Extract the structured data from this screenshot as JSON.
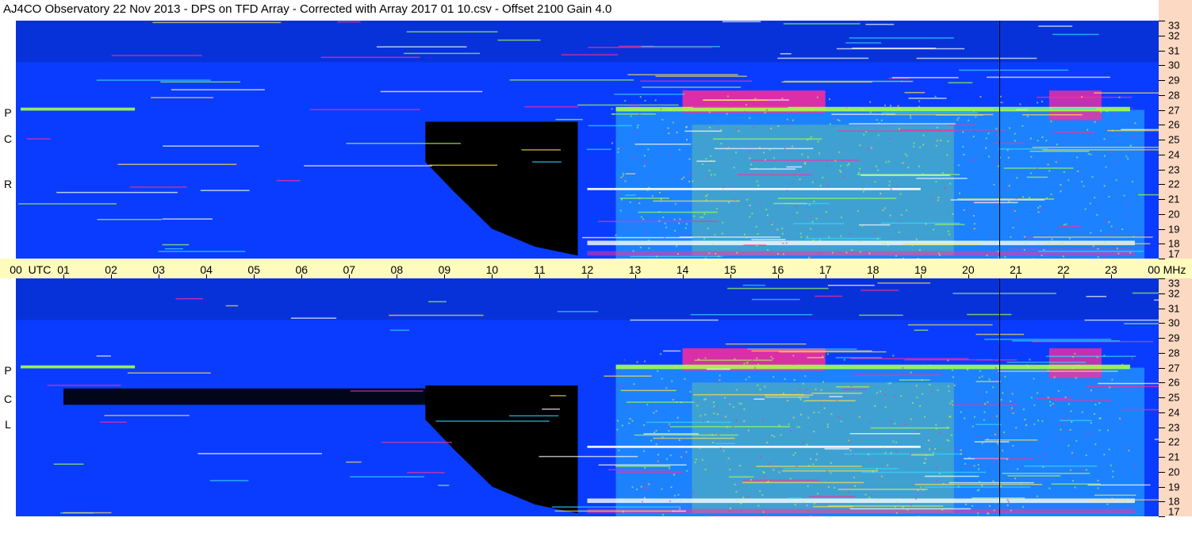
{
  "title": "AJ4CO Observatory  22 Nov 2013  -  DPS on TFD Array  -  Corrected with Array 2017 01 10.csv  -  Offset 2100  Gain 4.0",
  "panels": [
    {
      "id": "rcp",
      "polarization_label": [
        "R",
        "C",
        "P"
      ]
    },
    {
      "id": "lcp",
      "polarization_label": [
        "L",
        "C",
        "P"
      ]
    }
  ],
  "time_axis": {
    "labels": [
      "00",
      "UTC",
      "01",
      "02",
      "03",
      "04",
      "05",
      "06",
      "07",
      "08",
      "09",
      "10",
      "11",
      "12",
      "13",
      "14",
      "15",
      "16",
      "17",
      "18",
      "19",
      "20",
      "21",
      "22",
      "23",
      "00",
      "MHz"
    ]
  },
  "freq_axis": {
    "labels": [
      "33",
      "32",
      "31",
      "30",
      "29",
      "28",
      "27",
      "26",
      "25",
      "24",
      "23",
      "22",
      "21",
      "20",
      "19",
      "18",
      "17"
    ]
  },
  "colors": {
    "background_quiet": "#0a3cff",
    "absorption": "#000000",
    "time_band": "#fffbbd",
    "freq_band": "#fbd9c2",
    "intense_low": "#33d8ff",
    "intense_mid": "#a6ff4d",
    "intense_high": "#ff2d9a"
  },
  "chart_data": {
    "type": "heatmap",
    "title": "AJ4CO Observatory  22 Nov 2013  -  DPS on TFD Array  -  Corrected with Array 2017 01 10.csv  -  Offset 2100  Gain 4.0",
    "x_unit": "UTC hours",
    "y_unit": "MHz",
    "xlim": [
      0,
      24
    ],
    "ylim": [
      17,
      33
    ],
    "x_ticks": [
      0,
      1,
      2,
      3,
      4,
      5,
      6,
      7,
      8,
      9,
      10,
      11,
      12,
      13,
      14,
      15,
      16,
      17,
      18,
      19,
      20,
      21,
      22,
      23,
      24
    ],
    "y_ticks": [
      17,
      18,
      19,
      20,
      21,
      22,
      23,
      24,
      25,
      26,
      27,
      28,
      29,
      30,
      31,
      32,
      33
    ],
    "series": [
      {
        "name": "RCP"
      },
      {
        "name": "LCP"
      }
    ],
    "marker_time_utc": 20.65
  }
}
